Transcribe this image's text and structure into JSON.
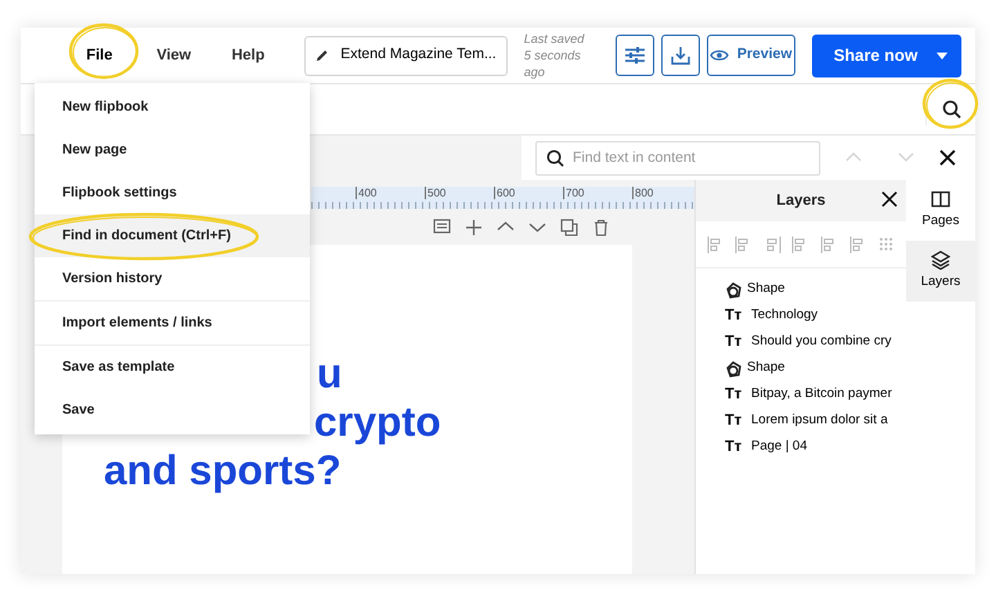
{
  "menubar": [
    {
      "label": "File",
      "selected": true,
      "circled": true
    },
    {
      "label": "View",
      "selected": false,
      "circled": false
    },
    {
      "label": "Help",
      "selected": false,
      "circled": false
    }
  ],
  "doc_title": "Extend Magazine Tem...",
  "last_saved": "Last saved 5 seconds ago",
  "preview": "Preview",
  "share": "Share now",
  "search_button": {
    "circled": true
  },
  "find": {
    "placeholder": "Find text in content",
    "prev_disabled": true,
    "next_disabled": true
  },
  "file_menu": [
    {
      "label": "New flipbook",
      "hovered": false,
      "circled": false,
      "divider_after": false
    },
    {
      "label": "New page",
      "hovered": false,
      "circled": false,
      "divider_after": false
    },
    {
      "label": "Flipbook settings",
      "hovered": false,
      "circled": false,
      "divider_after": false
    },
    {
      "label": "Find in document (Ctrl+F)",
      "hovered": true,
      "circled": true,
      "divider_after": false
    },
    {
      "label": "Version history",
      "hovered": false,
      "circled": false,
      "divider_after": true
    },
    {
      "label": "Import elements / links",
      "hovered": false,
      "circled": false,
      "divider_after": true
    },
    {
      "label": "Save as template",
      "hovered": false,
      "circled": false,
      "divider_after": false
    },
    {
      "label": "Save",
      "hovered": false,
      "circled": false,
      "divider_after": false
    }
  ],
  "ruler": [
    "400",
    "500",
    "600",
    "700",
    "800"
  ],
  "page_heading": [
    "u",
    "crypto",
    "and sports?"
  ],
  "layers_panel": {
    "title": "Layers",
    "items": [
      {
        "kind": "shape",
        "label": "Shape"
      },
      {
        "kind": "text",
        "icon": "Tт",
        "label": "Technology"
      },
      {
        "kind": "text",
        "icon": "Tт",
        "label": "Should you combine cry"
      },
      {
        "kind": "shape",
        "label": "Shape"
      },
      {
        "kind": "text",
        "icon": "Tт",
        "label": "Bitpay, a Bitcoin paymer"
      },
      {
        "kind": "text",
        "icon": "Tт",
        "label": "Lorem ipsum dolor sit a"
      },
      {
        "kind": "text",
        "icon": "Tт",
        "label": "Page | 04"
      }
    ]
  },
  "rail": [
    {
      "kind": "pages",
      "label": "Pages",
      "selected": false
    },
    {
      "kind": "layers",
      "label": "Layers",
      "selected": true
    }
  ]
}
